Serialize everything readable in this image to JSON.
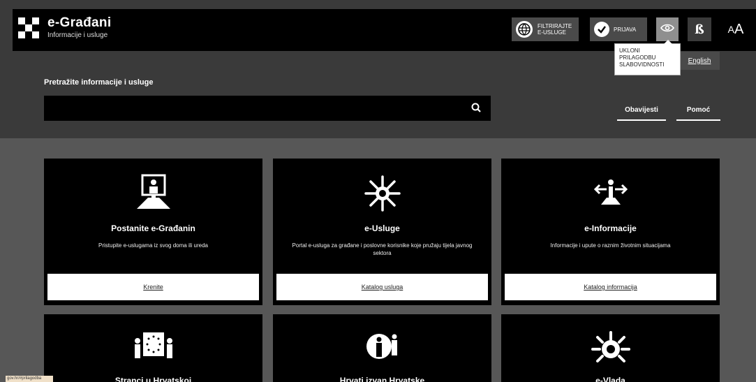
{
  "header": {
    "title": "e-Građani",
    "subtitle": "Informacije i usluge",
    "filter_line1": "FILTRIRAJTE",
    "filter_line2": "E-USLUGE",
    "login_label": "PRIJAVA",
    "font_button_label": "ß",
    "text_size_small": "A",
    "text_size_big": "A"
  },
  "tooltip": {
    "line1": "UKLONI",
    "line2": "PRILAGODBU",
    "line3": "SLABOVIDNOSTI"
  },
  "language_label": "English",
  "search": {
    "label": "Pretražite informacije i usluge",
    "value": "",
    "placeholder": ""
  },
  "links": {
    "notices": "Obavijesti",
    "help": "Pomoć"
  },
  "cards": [
    {
      "title": "Postanite e-Građanin",
      "desc": "Pristupite e-uslugama iz svog doma ili ureda",
      "button": "Krenite",
      "icon": "computer-user-icon"
    },
    {
      "title": "e-Usluge",
      "desc": "Portal e-usluga za građane i poslovne korisnike koje pružaju tijela javnog sektora",
      "button": "Katalog usluga",
      "icon": "services-burst-icon"
    },
    {
      "title": "e-Informacije",
      "desc": "Informacije i upute o raznim životnim situacijama",
      "button": "Katalog informacija",
      "icon": "information-person-icon"
    }
  ],
  "cards_bottom": [
    {
      "title": "Stranci u Hrvatskoj",
      "icon": "eu-foreigners-icon"
    },
    {
      "title": "Hrvati izvan Hrvatske",
      "icon": "croats-abroad-icon"
    },
    {
      "title": "e-Vlada",
      "icon": "government-gear-icon"
    }
  ],
  "status_bar": "gov.hr/#prilagodba"
}
